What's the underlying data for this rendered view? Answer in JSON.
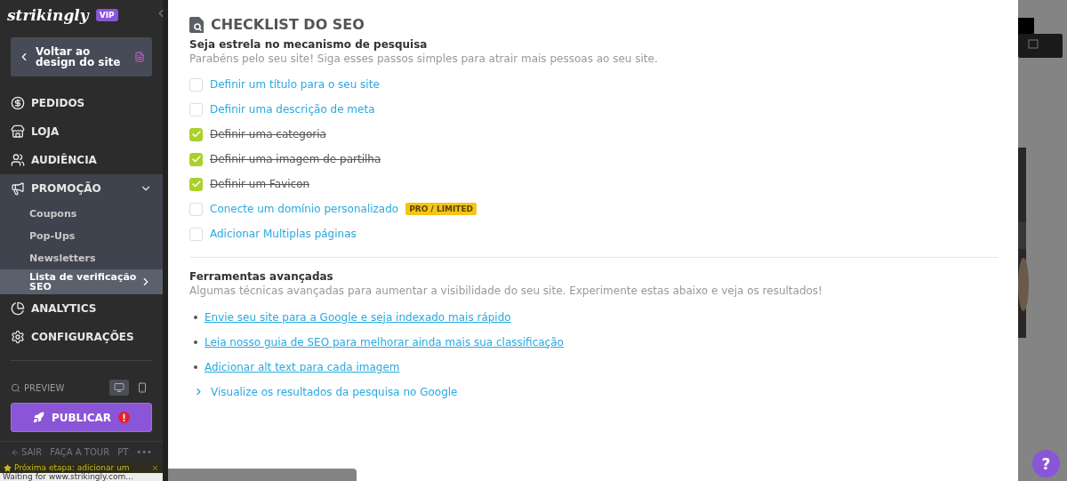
{
  "sidebar": {
    "logo": "strikingly",
    "badge": "VIP",
    "back_button": "Voltar ao design do site",
    "nav": [
      {
        "label": "PEDIDOS"
      },
      {
        "label": "LOJA"
      },
      {
        "label": "AUDIÊNCIA"
      },
      {
        "label": "PROMOÇÃO",
        "expanded": true,
        "children": [
          {
            "label": "Coupons",
            "selected": false
          },
          {
            "label": "Pop-Ups",
            "selected": false
          },
          {
            "label": "Newsletters",
            "selected": false
          },
          {
            "label": "Lista de verificação SEO",
            "selected": true
          }
        ]
      },
      {
        "label": "ANALYTICS"
      },
      {
        "label": "CONFIGURAÇÕES"
      }
    ],
    "preview": "PREVIEW",
    "publish": "PUBLICAR",
    "footer": [
      "SAIR",
      "FAÇA A TOUR",
      "PT",
      "•••"
    ],
    "toast": "Próxima etapa: adicionar um"
  },
  "status_bar": "Waiting for www.strikingly.com...",
  "main": {
    "title": "CHECKLIST DO SEO",
    "heading": "Seja estrela no mecanismo de pesquisa",
    "intro": "Parabéns pelo seu site! Siga esses passos simples para atrair mais pessoas ao seu site.",
    "checklist": [
      {
        "label": "Definir um título para o seu site",
        "checked": false
      },
      {
        "label": "Definir uma descrição de meta",
        "checked": false
      },
      {
        "label": "Definir uma categoria",
        "checked": true
      },
      {
        "label": "Definir uma imagem de partilha",
        "checked": true
      },
      {
        "label": "Definir um Favicon",
        "checked": true
      },
      {
        "label": "Conecte um domínio personalizado",
        "checked": false,
        "badge": "PRO / LIMITED"
      },
      {
        "label": "Adicionar Multiplas páginas",
        "checked": false
      }
    ],
    "tools_heading": "Ferramentas avançadas",
    "tools_intro": "Algumas técnicas avançadas para aumentar a visibilidade do seu site. Experimente estas abaixo e veja os resultados!",
    "tools": [
      {
        "label": "Envie seu site para a Google e seja indexado mais rápido",
        "kind": "bullet"
      },
      {
        "label": "Leia nosso guia de SEO para melhorar ainda mais sua classificação",
        "kind": "bullet"
      },
      {
        "label": "Adicionar alt text para cada imagem",
        "kind": "bullet"
      },
      {
        "label": "Visualize os resultados da pesquisa no Google",
        "kind": "chevron"
      }
    ]
  },
  "help_button": "?"
}
